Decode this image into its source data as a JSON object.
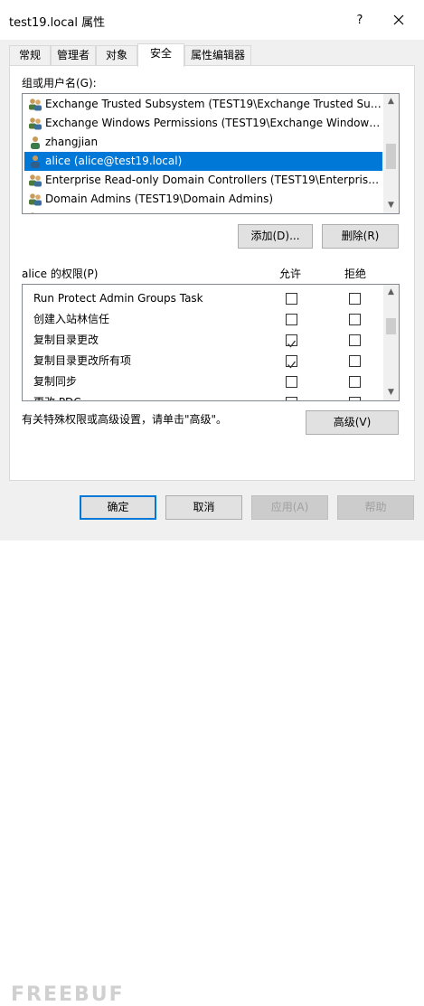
{
  "window": {
    "title": "test19.local 属性",
    "help_label": "?",
    "close_label": "✕"
  },
  "tabs": [
    {
      "label": "常规"
    },
    {
      "label": "管理者"
    },
    {
      "label": "对象"
    },
    {
      "label": "安全"
    },
    {
      "label": "属性编辑器"
    }
  ],
  "active_tab": "安全",
  "principals": {
    "label": "组或用户名(G):",
    "items": [
      {
        "label": "Exchange Trusted Subsystem (TEST19\\Exchange Trusted Subs...",
        "icon": "group-icon"
      },
      {
        "label": "Exchange Windows Permissions (TEST19\\Exchange Windows P...",
        "icon": "group-icon"
      },
      {
        "label": "zhangjian",
        "icon": "user-icon"
      },
      {
        "label": "alice (alice@test19.local)",
        "icon": "user-icon",
        "selected": true
      },
      {
        "label": "Enterprise Read-only Domain Controllers (TEST19\\Enterprise ...",
        "icon": "group-icon"
      },
      {
        "label": "Domain Admins (TEST19\\Domain Admins)",
        "icon": "group-icon"
      }
    ],
    "add_label": "添加(D)...",
    "remove_label": "删除(R)"
  },
  "permissions": {
    "label": "alice 的权限(P)",
    "allow_header": "允许",
    "deny_header": "拒绝",
    "rows": [
      {
        "name": "Run Protect Admin Groups Task",
        "allow": false,
        "deny": false
      },
      {
        "name": "创建入站林信任",
        "allow": false,
        "deny": false
      },
      {
        "name": "复制目录更改",
        "allow": true,
        "deny": false
      },
      {
        "name": "复制目录更改所有项",
        "allow": true,
        "deny": false
      },
      {
        "name": "复制同步",
        "allow": false,
        "deny": false
      },
      {
        "name": "更改 PDC",
        "allow": false,
        "deny": false
      }
    ],
    "advanced_hint": "有关特殊权限或高级设置，请单击\"高级\"。",
    "advanced_label": "高级(V)"
  },
  "footer": {
    "ok_label": "确定",
    "cancel_label": "取消",
    "apply_label": "应用(A)",
    "help_label": "帮助"
  },
  "watermark": "FREEBUF",
  "colors": {
    "selection": "#0078d7",
    "check": "#333333"
  }
}
